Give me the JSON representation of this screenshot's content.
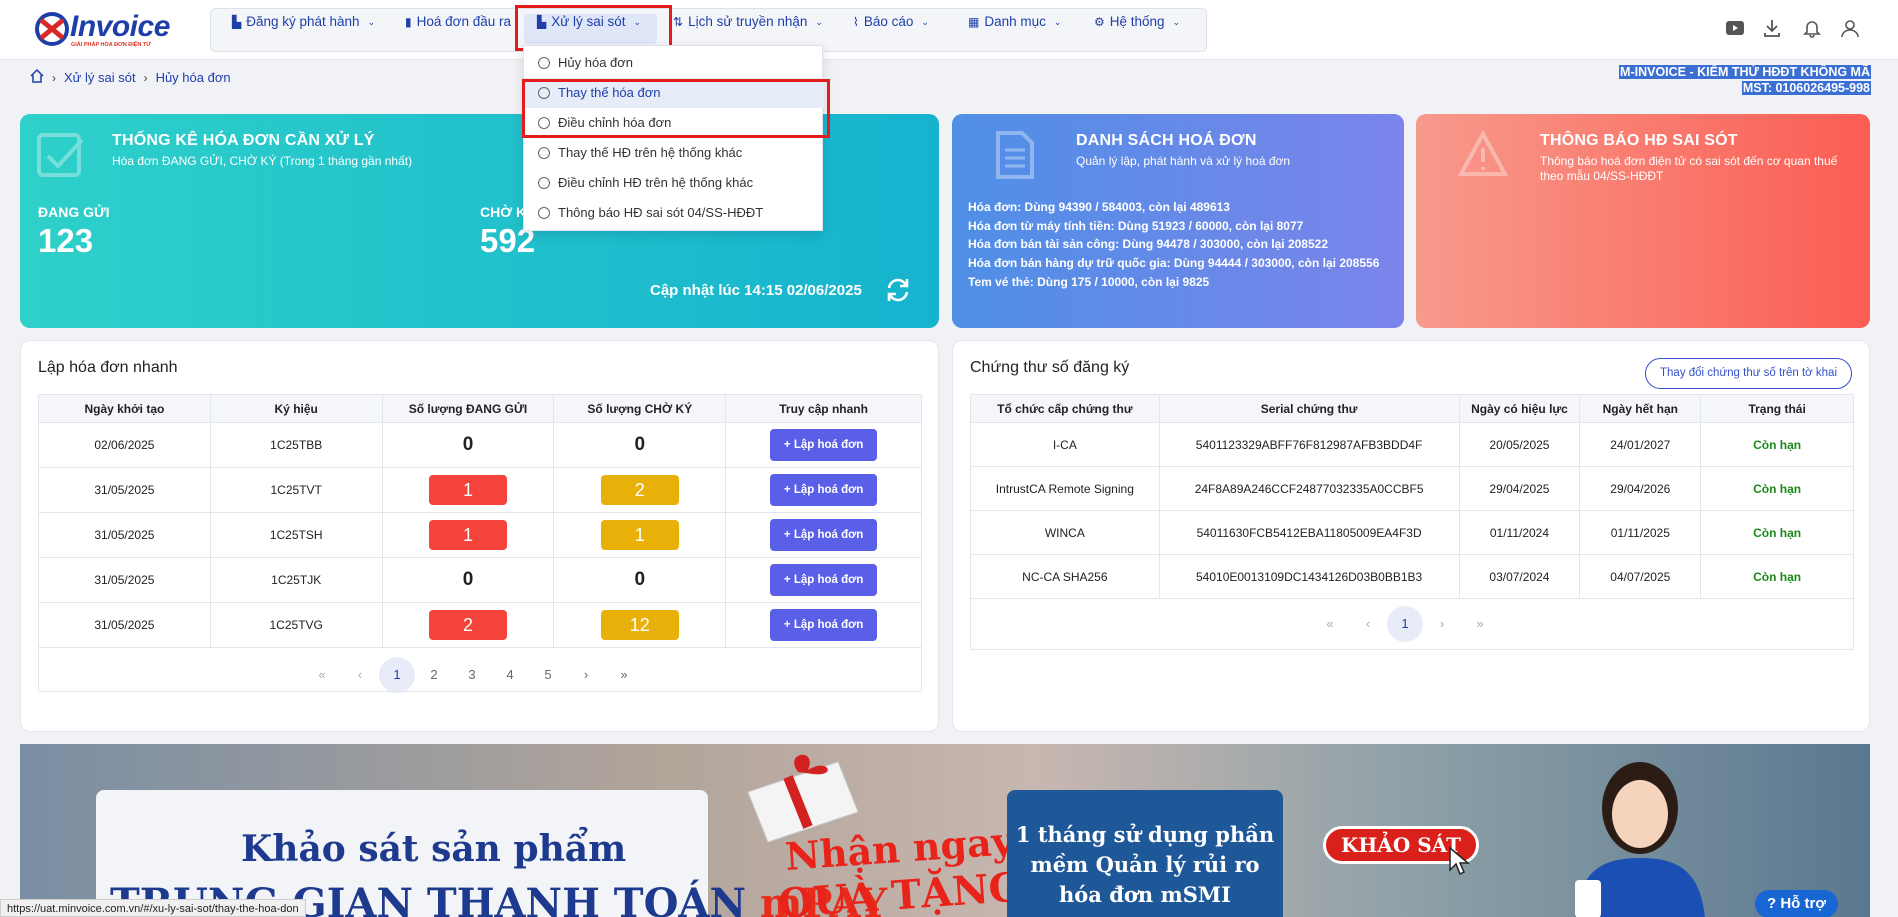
{
  "app": {
    "logo_text": "Invoice",
    "logo_sub": "GIẢI PHÁP HÓA ĐƠN ĐIỆN TỬ"
  },
  "nav": {
    "items": [
      {
        "label": "Đăng ký phát hành",
        "icon": "register-icon",
        "chevron": true
      },
      {
        "label": "Hoá đơn đầu ra",
        "icon": "document-icon",
        "chevron": false
      },
      {
        "label": "Xử lý sai sót",
        "icon": "error-doc-icon",
        "chevron": true
      },
      {
        "label": "Lịch sử truyền nhận",
        "icon": "transfer-icon",
        "chevron": true
      },
      {
        "label": "Báo cáo",
        "icon": "chart-icon",
        "chevron": true
      },
      {
        "label": "Danh mục",
        "icon": "grid-icon",
        "chevron": true
      },
      {
        "label": "Hệ thống",
        "icon": "gear-icon",
        "chevron": true
      }
    ]
  },
  "dropdown": {
    "items": [
      {
        "label": "Hủy hóa đơn"
      },
      {
        "label": "Thay thế hóa đơn"
      },
      {
        "label": "Điều chỉnh hóa đơn"
      },
      {
        "label": "Thay thế HĐ trên hệ thống khác"
      },
      {
        "label": "Điều chỉnh HĐ trên hệ thống khác"
      },
      {
        "label": "Thông báo HĐ sai sót 04/SS-HĐĐT"
      }
    ]
  },
  "breadcrumb": {
    "level1": "Xử lý sai sót",
    "level2": "Hủy hóa đơn"
  },
  "company": {
    "name": "M-INVOICE - KIỂM THỬ HĐĐT KHÔNG MÃ",
    "mst": "MST: 0106026495-998"
  },
  "stats_card": {
    "title": "THỐNG KÊ HÓA ĐƠN CẦN XỬ LÝ",
    "subtitle": "Hóa đơn ĐANG GỬI, CHỜ KÝ (Trong 1 tháng gần nhất)",
    "sending_label": "ĐANG GỬI",
    "sending_value": "123",
    "waiting_label": "CHỜ K",
    "waiting_value": "592",
    "updated": "Cập nhật lúc 14:15 02/06/2025"
  },
  "list_card": {
    "title": "DANH SÁCH HOÁ ĐƠN",
    "subtitle": "Quản lý lập, phát hành và xử lý hoá đơn",
    "lines": [
      "Hóa đơn: Dùng 94390 / 584003, còn lại 489613",
      "Hóa đơn từ máy tính tiền: Dùng 51923 / 60000, còn lại 8077",
      "Hóa đơn bán tài sản công: Dùng 94478 / 303000, còn lại 208522",
      "Hóa đơn bán hàng dự trữ quốc gia: Dùng 94444 / 303000, còn lại 208556",
      "Tem vé thẻ: Dùng 175 / 10000, còn lại 9825"
    ]
  },
  "notice_card": {
    "title": "THÔNG BÁO HĐ SAI SÓT",
    "subtitle": "Thông báo hoá đơn điện tử có sai sót đến cơ quan thuế theo mẫu 04/SS-HĐĐT"
  },
  "quick": {
    "title": "Lập hóa đơn nhanh",
    "headers": [
      "Ngày khởi tạo",
      "Ký hiệu",
      "Số lượng ĐANG GỬI",
      "Số lượng CHỜ KÝ",
      "Truy cập nhanh"
    ],
    "button_label": "Lập hoá đơn",
    "rows": [
      {
        "date": "02/06/2025",
        "code": "1C25TBB",
        "sending": "0",
        "waiting": "0",
        "sending_badge": false,
        "waiting_badge": false
      },
      {
        "date": "31/05/2025",
        "code": "1C25TVT",
        "sending": "1",
        "waiting": "2",
        "sending_badge": true,
        "waiting_badge": true
      },
      {
        "date": "31/05/2025",
        "code": "1C25TSH",
        "sending": "1",
        "waiting": "1",
        "sending_badge": true,
        "waiting_badge": true
      },
      {
        "date": "31/05/2025",
        "code": "1C25TJK",
        "sending": "0",
        "waiting": "0",
        "sending_badge": false,
        "waiting_badge": false
      },
      {
        "date": "31/05/2025",
        "code": "1C25TVG",
        "sending": "2",
        "waiting": "12",
        "sending_badge": true,
        "waiting_badge": true
      }
    ],
    "pages": [
      "1",
      "2",
      "3",
      "4",
      "5"
    ]
  },
  "certs": {
    "title": "Chứng thư số đăng ký",
    "change_button": "Thay đổi chứng thư số trên tờ khai",
    "headers": [
      "Tổ chức cấp chứng thư",
      "Serial chứng thư",
      "Ngày có hiệu lực",
      "Ngày hết hạn",
      "Trạng thái"
    ],
    "rows": [
      {
        "org": "I-CA",
        "serial": "5401123329ABFF76F812987AFB3BDD4F",
        "from": "20/05/2025",
        "to": "24/01/2027",
        "status": "Còn hạn"
      },
      {
        "org": "IntrustCA Remote Signing",
        "serial": "24F8A89A246CCF24877032335A0CCBF5",
        "from": "29/04/2025",
        "to": "29/04/2026",
        "status": "Còn hạn"
      },
      {
        "org": "WINCA",
        "serial": "54011630FCB5412EBA11805009EA4F3D",
        "from": "01/11/2024",
        "to": "01/11/2025",
        "status": "Còn hạn"
      },
      {
        "org": "NC-CA SHA256",
        "serial": "54010E0013109DC1434126D03B0BB1B3",
        "from": "03/07/2024",
        "to": "04/07/2025",
        "status": "Còn hạn"
      }
    ],
    "pages": [
      "1"
    ]
  },
  "banner": {
    "survey_title": "Khảo sát sản phẩm",
    "survey_sub_a": "TRUNG GIAN THANH TOÁN ",
    "survey_sub_b": "mPAY",
    "gift_1": "Nhận ngay",
    "gift_2": "QUÀ TẶNG",
    "offer": "1 tháng sử dụng phần mềm Quản lý rủi ro hóa đơn mSMI",
    "survey_button": "KHẢO SÁT",
    "help": "Hỗ trợ"
  },
  "status_url": "https://uat.minvoice.com.vn/#/xu-ly-sai-sot/thay-the-hoa-don"
}
